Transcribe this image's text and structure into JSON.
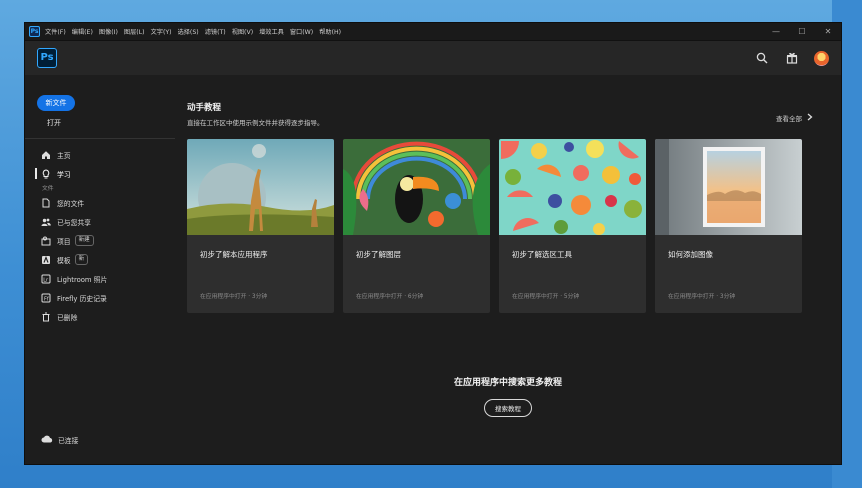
{
  "menubar": {
    "items": [
      "文件(F)",
      "编辑(E)",
      "图像(I)",
      "图层(L)",
      "文字(Y)",
      "选择(S)",
      "滤镜(T)",
      "视图(V)",
      "增效工具",
      "窗口(W)",
      "帮助(H)"
    ]
  },
  "window_controls": {
    "minimize": "—",
    "maximize": "☐",
    "close": "✕"
  },
  "header": {
    "logo": "Ps"
  },
  "sidebar": {
    "new_file": "新文件",
    "open": "打开",
    "home": "主页",
    "learn": "学习",
    "files_section": "文件",
    "your_files": "您的文件",
    "shared": "已与您共享",
    "projects": "项目",
    "projects_badge": "新建",
    "templates": "模板",
    "templates_badge": "新",
    "lightroom": "Lightroom 照片",
    "firefly": "Firefly 历史记录",
    "deleted": "已删除",
    "connected": "已连接"
  },
  "main": {
    "title": "动手教程",
    "subtitle": "直接在工作区中使用示例文件并获得逐步指导。",
    "view_all": "查看全部",
    "cards": [
      {
        "title": "初步了解本应用程序",
        "meta": "在应用程序中打开 · 3分钟"
      },
      {
        "title": "初步了解图层",
        "meta": "在应用程序中打开 · 6分钟"
      },
      {
        "title": "初步了解选区工具",
        "meta": "在应用程序中打开 · 5分钟"
      },
      {
        "title": "如何添加图像",
        "meta": "在应用程序中打开 · 3分钟"
      }
    ],
    "more_title": "在应用程序中搜索更多教程",
    "search_button": "搜索教程"
  }
}
